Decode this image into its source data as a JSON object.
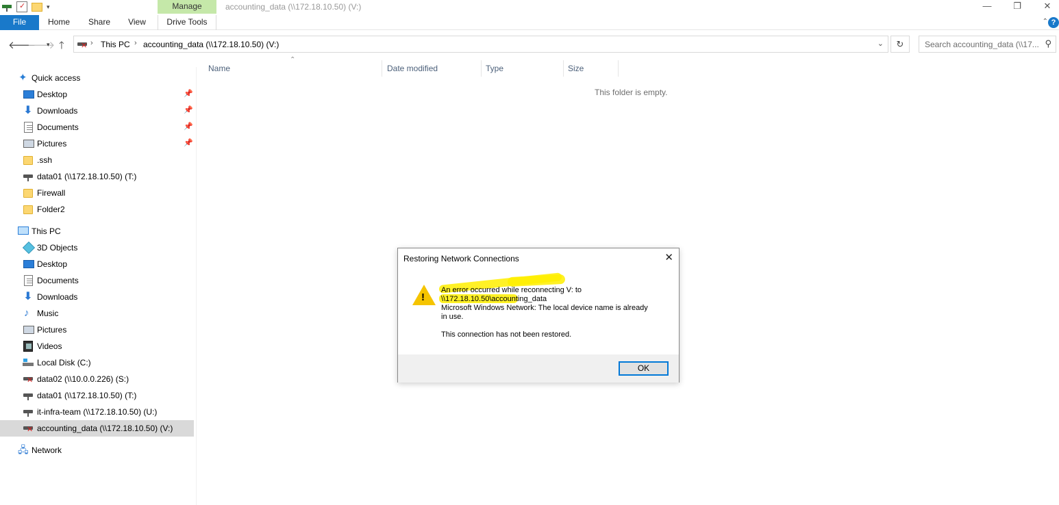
{
  "window": {
    "title": "accounting_data (\\\\172.18.10.50) (V:)",
    "manage_tab": "Manage"
  },
  "ribbon": {
    "tabs": [
      "File",
      "Home",
      "Share",
      "View",
      "Drive Tools"
    ],
    "help": "?"
  },
  "address": {
    "crumbs": [
      "This PC",
      "accounting_data (\\\\172.18.10.50) (V:)"
    ],
    "search_placeholder": "Search accounting_data (\\\\17..."
  },
  "nav": {
    "quick_access": {
      "label": "Quick access",
      "items": [
        {
          "label": "Desktop",
          "icon": "desktop-icon",
          "pinned": true
        },
        {
          "label": "Downloads",
          "icon": "download-icon",
          "pinned": true
        },
        {
          "label": "Documents",
          "icon": "document-icon",
          "pinned": true
        },
        {
          "label": "Pictures",
          "icon": "pictures-icon",
          "pinned": true
        },
        {
          "label": ".ssh",
          "icon": "folder-icon",
          "pinned": false
        },
        {
          "label": "data01 (\\\\172.18.10.50) (T:)",
          "icon": "network-drive-icon",
          "pinned": false
        },
        {
          "label": "Firewall",
          "icon": "folder-icon",
          "pinned": false
        },
        {
          "label": "Folder2",
          "icon": "folder-icon",
          "pinned": false
        }
      ]
    },
    "this_pc": {
      "label": "This PC",
      "items": [
        {
          "label": "3D Objects",
          "icon": "3d-objects-icon"
        },
        {
          "label": "Desktop",
          "icon": "desktop-icon"
        },
        {
          "label": "Documents",
          "icon": "document-icon"
        },
        {
          "label": "Downloads",
          "icon": "download-icon"
        },
        {
          "label": "Music",
          "icon": "music-icon"
        },
        {
          "label": "Pictures",
          "icon": "pictures-icon"
        },
        {
          "label": "Videos",
          "icon": "videos-icon"
        },
        {
          "label": "Local Disk (C:)",
          "icon": "local-disk-icon"
        },
        {
          "label": "data02 (\\\\10.0.0.226) (S:)",
          "icon": "disconnected-drive-icon"
        },
        {
          "label": "data01 (\\\\172.18.10.50) (T:)",
          "icon": "network-drive-icon"
        },
        {
          "label": "it-infra-team (\\\\172.18.10.50) (U:)",
          "icon": "network-drive-icon"
        },
        {
          "label": "accounting_data (\\\\172.18.10.50) (V:)",
          "icon": "disconnected-drive-icon"
        }
      ]
    },
    "network": {
      "label": "Network"
    }
  },
  "content": {
    "columns": [
      "Name",
      "Date modified",
      "Type",
      "Size"
    ],
    "empty_message": "This folder is empty."
  },
  "dialog": {
    "title": "Restoring Network Connections",
    "message_lines": [
      "An error occurred while reconnecting V: to",
      "\\\\172.18.10.50\\accounting_data",
      "Microsoft Windows Network: The local device name is already",
      "in use."
    ],
    "sub_message": "This connection has not been restored.",
    "ok_label": "OK"
  },
  "colors": {
    "accent": "#1979ca",
    "manage_tab": "#c5e8a9",
    "highlight": "#ffee00",
    "warning": "#f5c400"
  }
}
